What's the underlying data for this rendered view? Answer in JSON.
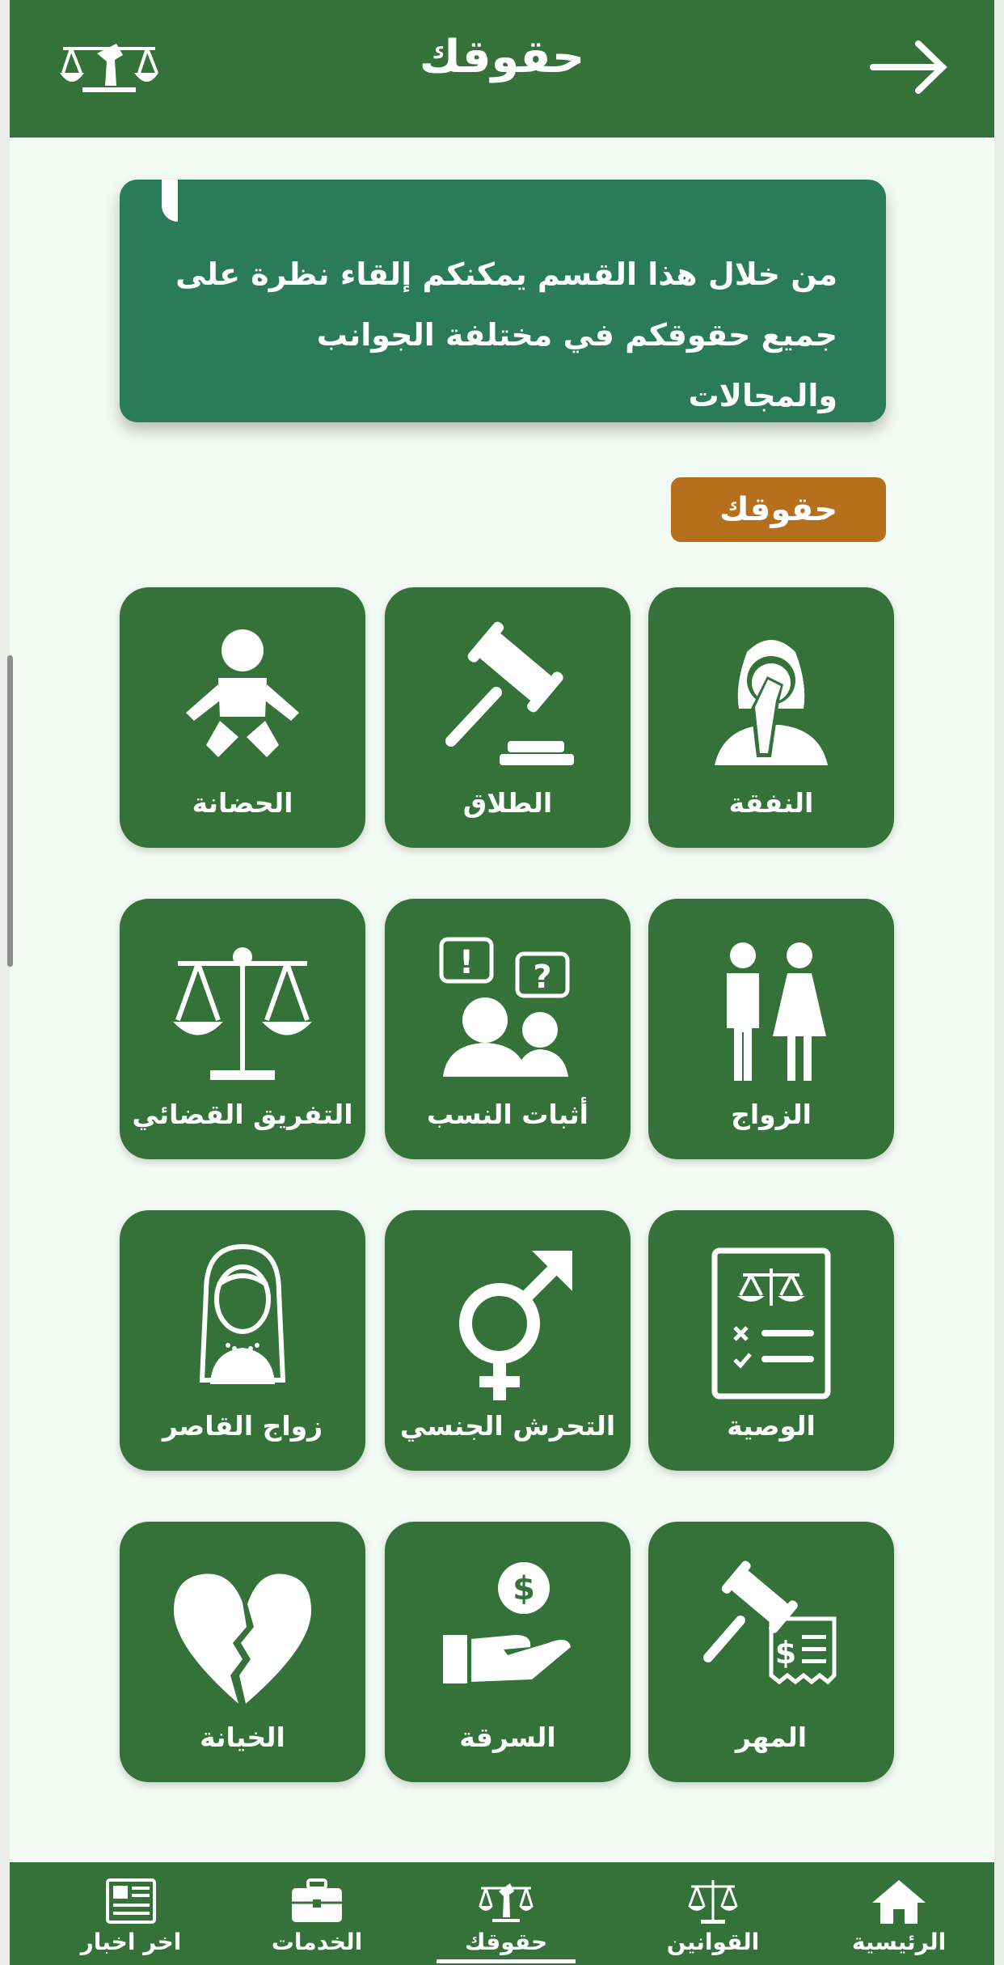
{
  "header": {
    "title": "حقوقك"
  },
  "banner": {
    "text": "من خلال هذا القسم يمكنكم إلقاء نظرة على جميع حقوقكم في مختلفة الجوانب والمجالات"
  },
  "section": {
    "badge": "حقوقك"
  },
  "cards": [
    {
      "label": "النفقة",
      "icon": "woman-fist-icon"
    },
    {
      "label": "الطلاق",
      "icon": "gavel-icon"
    },
    {
      "label": "الحضانة",
      "icon": "baby-icon"
    },
    {
      "label": "الزواج",
      "icon": "man-woman-icon"
    },
    {
      "label": "أثبات النسب",
      "icon": "people-questions-icon"
    },
    {
      "label": "التفريق القضائي",
      "icon": "scales-icon"
    },
    {
      "label": "الوصية",
      "icon": "legal-document-icon"
    },
    {
      "label": "التحرش الجنسي",
      "icon": "gender-symbol-icon"
    },
    {
      "label": "زواج القاصر",
      "icon": "bride-icon"
    },
    {
      "label": "المهر",
      "icon": "gavel-receipt-icon"
    },
    {
      "label": "السرقة",
      "icon": "hand-money-icon"
    },
    {
      "label": "الخيانة",
      "icon": "broken-heart-icon"
    }
  ],
  "bottom_nav": {
    "items": [
      {
        "label": "الرئيسية",
        "icon": "home-icon"
      },
      {
        "label": "القوانين",
        "icon": "scales-icon"
      },
      {
        "label": "حقوقك",
        "icon": "rights-logo-icon"
      },
      {
        "label": "الخدمات",
        "icon": "briefcase-icon"
      },
      {
        "label": "اخر اخبار",
        "icon": "newspaper-icon"
      }
    ],
    "active": "حقوقك"
  },
  "colors": {
    "primary": "#35723a",
    "banner": "#2a7c58",
    "accent": "#b56f1d",
    "background": "#f3fcf4"
  }
}
